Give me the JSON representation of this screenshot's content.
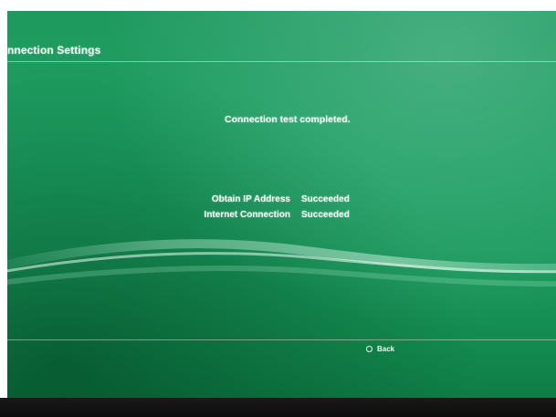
{
  "header": {
    "title": "nnection Settings"
  },
  "status": {
    "message": "Connection test completed."
  },
  "results": [
    {
      "label": "Obtain IP Address",
      "value": "Succeeded"
    },
    {
      "label": "Internet Connection",
      "value": "Succeeded"
    }
  ],
  "footer": {
    "back_icon": "circle-button-icon",
    "back_label": "Back"
  },
  "colors": {
    "background": "#1c9d60",
    "text": "#f4fff8"
  }
}
